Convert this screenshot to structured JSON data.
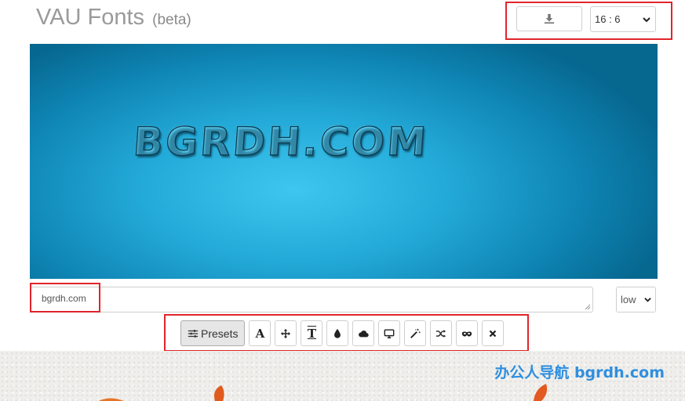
{
  "app": {
    "title": "VAU Fonts",
    "badge": "(beta)"
  },
  "header": {
    "aspect_ratio": "16 : 6"
  },
  "canvas": {
    "preview_text": "BGRDH.COM"
  },
  "editor": {
    "text_value": "bgrdh.com",
    "quality": "low"
  },
  "toolbar": {
    "presets_label": "Presets",
    "font_glyph": "A",
    "text_glyph": "T"
  },
  "banner": {
    "text": "办公人导航 bgrdh.com"
  },
  "colors": {
    "highlight": "#e0252b",
    "canvas_center": "#3ec6ef",
    "canvas_edge": "#06678f",
    "banner_text": "#2f8fe0"
  }
}
